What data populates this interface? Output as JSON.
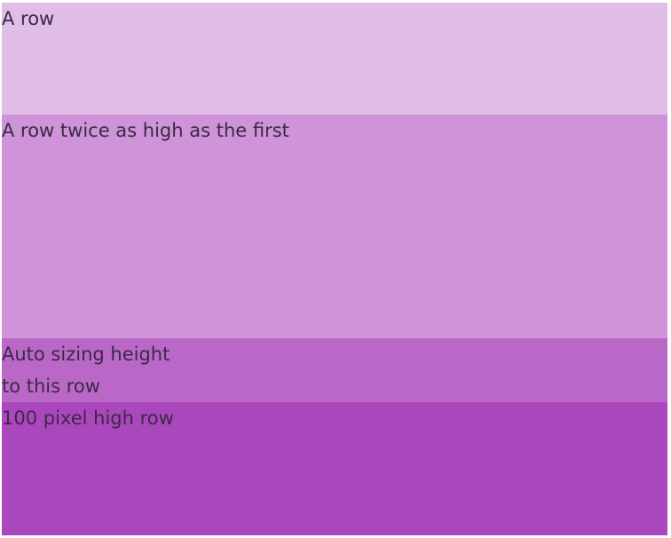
{
  "rows": [
    {
      "lines": [
        "A row"
      ],
      "color": "#e1bee7"
    },
    {
      "lines": [
        "A row twice as high as the first"
      ],
      "color": "#ce93d8"
    },
    {
      "lines": [
        "Auto sizing height",
        "to this row"
      ],
      "color": "#ba68c8"
    },
    {
      "lines": [
        "100 pixel high row"
      ],
      "color": "#ab47bc"
    }
  ]
}
